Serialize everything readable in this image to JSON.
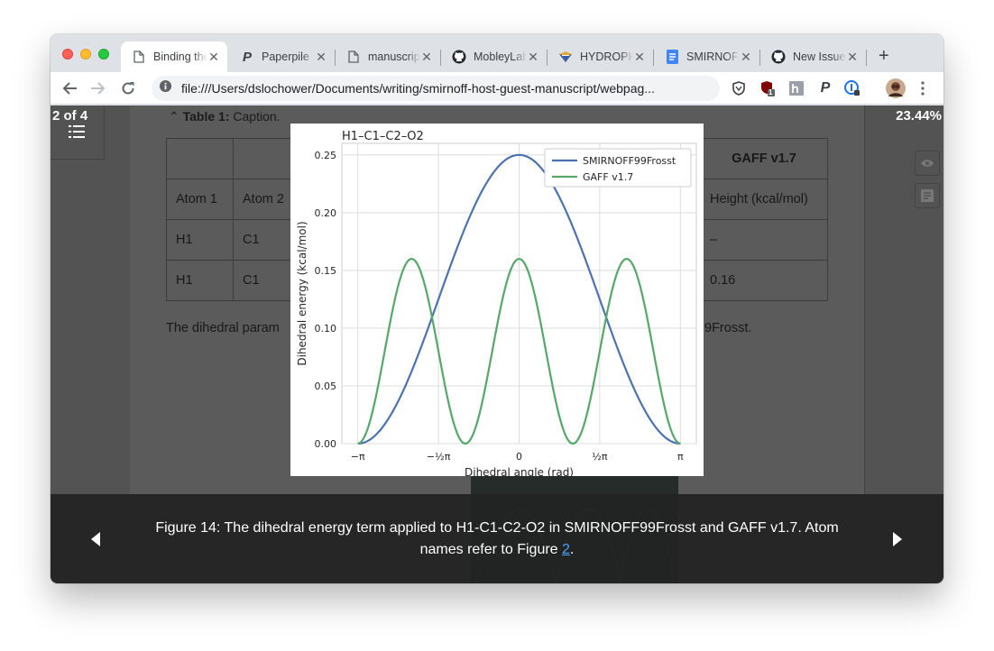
{
  "tabs": [
    {
      "title": "Binding thermodynamics",
      "favicon": "page-icon"
    },
    {
      "title": "Paperpile",
      "favicon": "paperpile-icon"
    },
    {
      "title": "manuscript",
      "favicon": "page-icon"
    },
    {
      "title": "MobleyLab",
      "favicon": "github-icon"
    },
    {
      "title": "HYDROPHOBIC",
      "favicon": "hydrophobic-icon"
    },
    {
      "title": "SMIRNOFF",
      "favicon": "docs-icon"
    },
    {
      "title": "New Issue",
      "favicon": "github-icon"
    }
  ],
  "toolbar": {
    "url": "file:///Users/dslochower/Documents/writing/smirnoff-host-guest-manuscript/webpag...",
    "badge_count": "1"
  },
  "viewer": {
    "counter": "2 of 4",
    "zoom": "23.44%"
  },
  "page": {
    "table_heading_label": "Table 1:",
    "table_heading_text": "Caption.",
    "header_row": [
      "",
      "",
      "",
      "",
      "",
      "GAFF v1.7"
    ],
    "col_row": [
      "Atom 1",
      "Atom 2",
      "",
      "",
      "",
      "Height (kcal/mol)"
    ],
    "rows": [
      [
        "H1",
        "C1",
        "",
        "",
        "",
        "–"
      ],
      [
        "H1",
        "C1",
        "",
        "",
        "",
        "0.16"
      ]
    ],
    "para_start": "The dihedral param",
    "para_end": "9Frosst."
  },
  "figure": {
    "caption_text": "Figure 14: The dihedral energy term applied to H1-C1-C2-O2 in SMIRNOFF99Frosst and GAFF v1.7. Atom names refer to Figure ",
    "caption_link": "2",
    "caption_end": "."
  },
  "chart_data": {
    "type": "line",
    "title": "H1–C1–C2–O2",
    "xlabel": "Dihedral angle (rad)",
    "ylabel": "Dihedral energy (kcal/mol)",
    "xlim": [
      -3.1416,
      3.1416
    ],
    "ylim": [
      0,
      0.26
    ],
    "xticks": [
      -3.1416,
      -1.5708,
      0,
      1.5708,
      3.1416
    ],
    "xtick_labels": [
      "−π",
      "−½π",
      "0",
      "½π",
      "π"
    ],
    "yticks": [
      0.0,
      0.05,
      0.1,
      0.15,
      0.2,
      0.25
    ],
    "ytick_labels": [
      "0.00",
      "0.05",
      "0.10",
      "0.15",
      "0.20",
      "0.25"
    ],
    "grid": true,
    "legend": "top-right",
    "series": [
      {
        "name": "SMIRNOFF99Frosst",
        "color": "#4c72b0",
        "peak": 0.25,
        "periodicity": 1,
        "x": [
          -3.1416,
          -2.3562,
          -1.5708,
          -0.7854,
          0,
          0.7854,
          1.5708,
          2.3562,
          3.1416
        ],
        "y": [
          0.0,
          0.0183,
          0.125,
          0.2317,
          0.25,
          0.2317,
          0.125,
          0.0183,
          0.0
        ]
      },
      {
        "name": "GAFF v1.7",
        "color": "#55a868",
        "peak": 0.16,
        "periodicity": 3,
        "x": [
          -3.1416,
          -2.0944,
          -1.0472,
          0,
          1.0472,
          2.0944,
          3.1416
        ],
        "y": [
          0.0,
          0.16,
          0.0,
          0.16,
          0.0,
          0.16,
          0.0
        ]
      }
    ]
  }
}
